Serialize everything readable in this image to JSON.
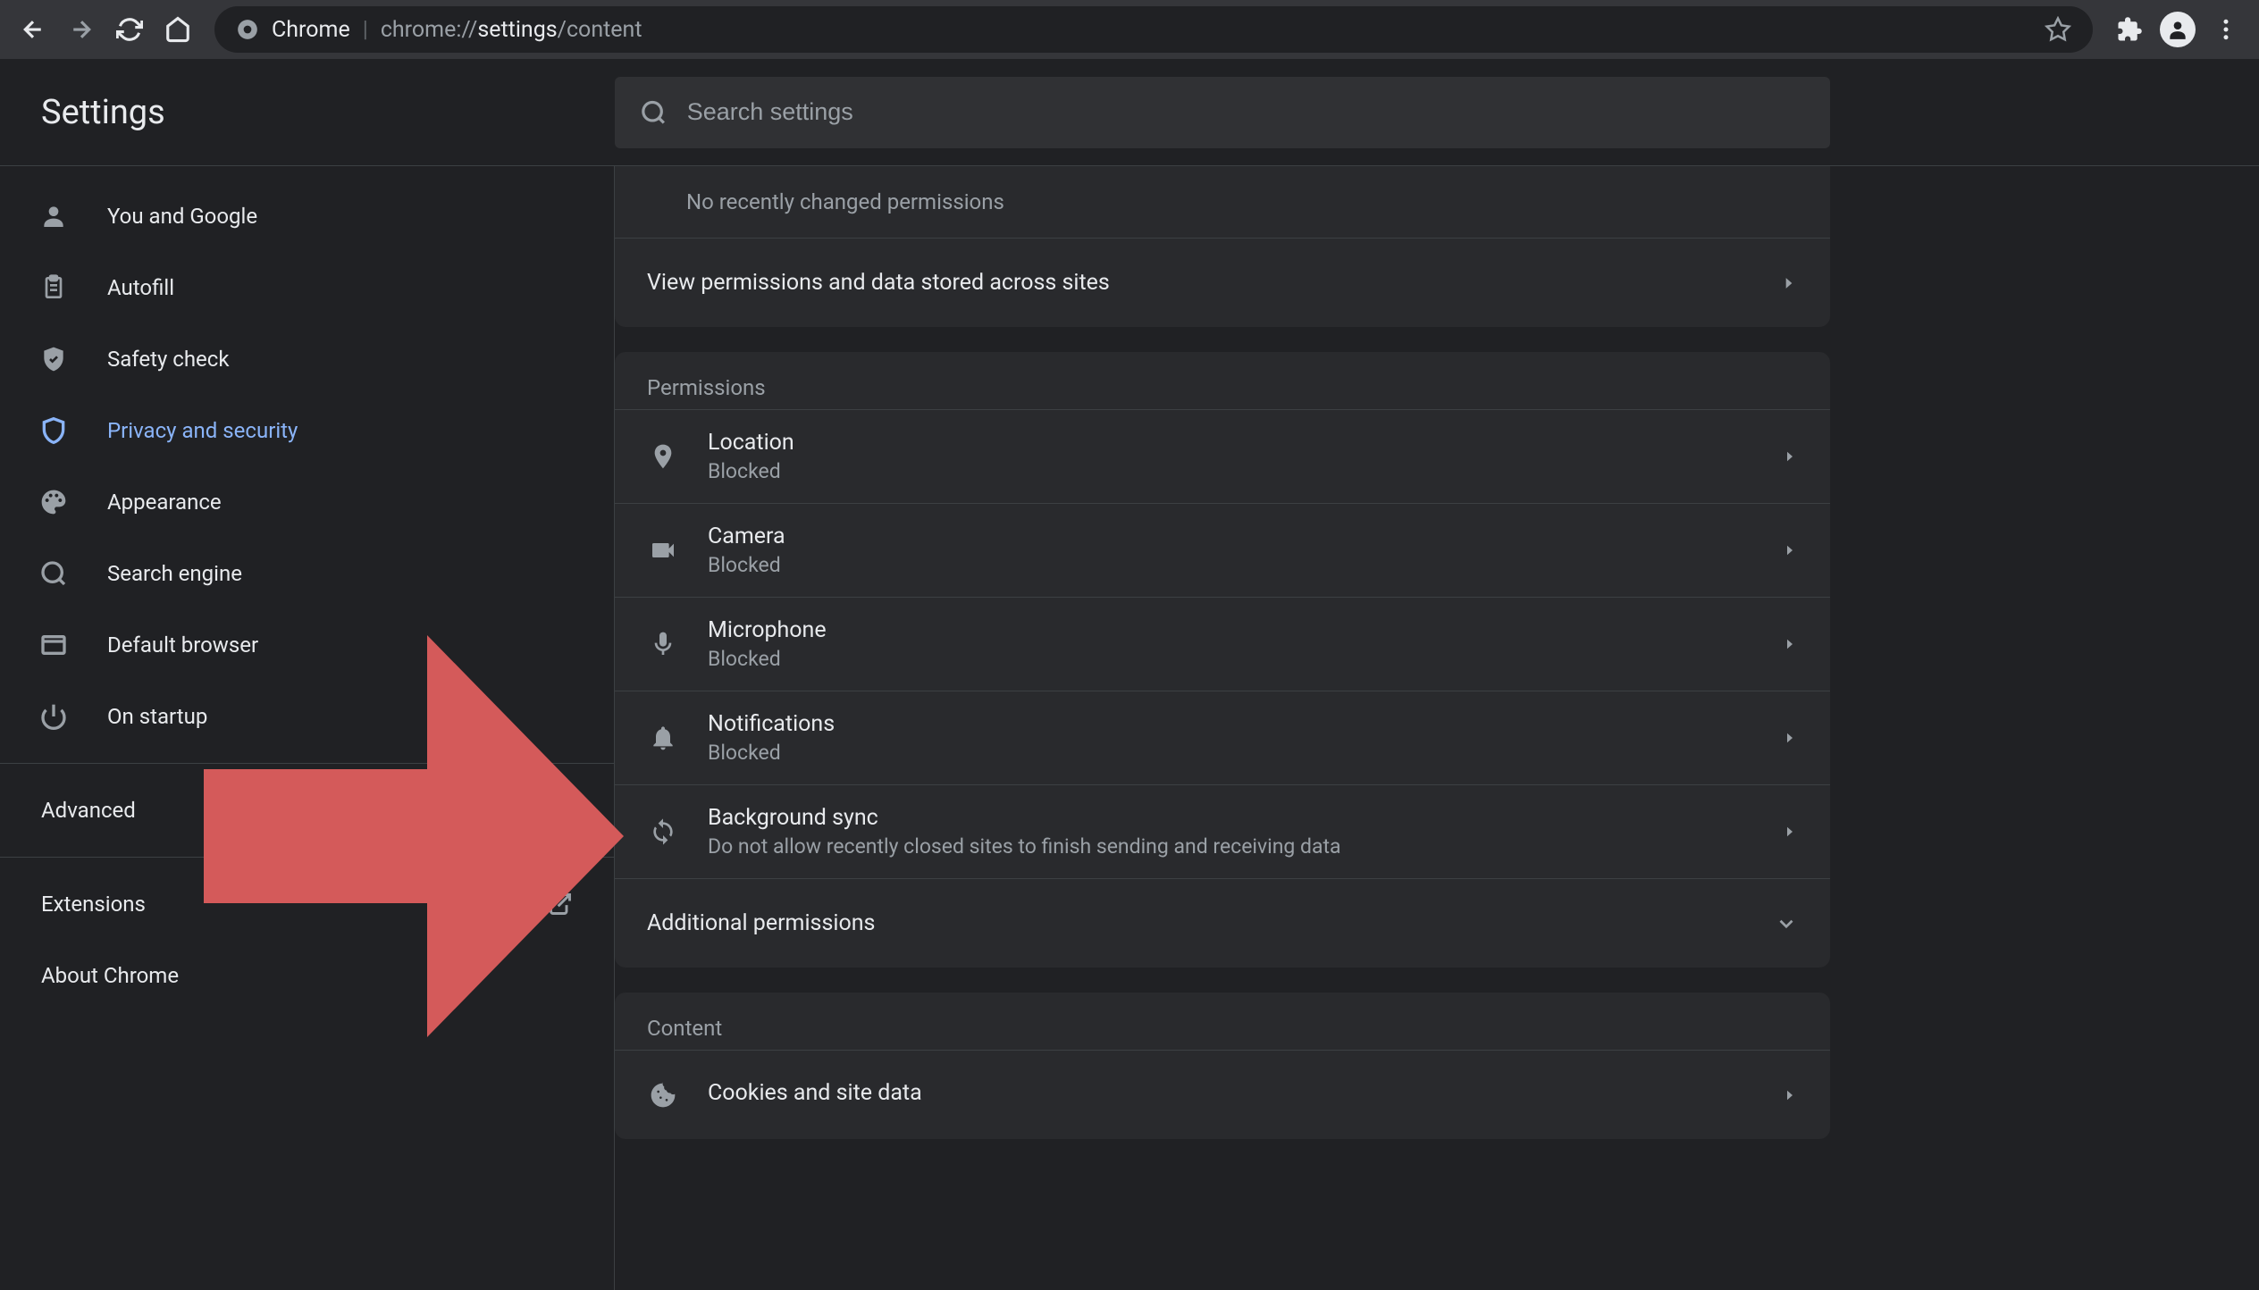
{
  "toolbar": {
    "browser_label": "Chrome",
    "url_prefix": "chrome://",
    "url_strong": "settings",
    "url_suffix": "/content"
  },
  "header": {
    "title": "Settings",
    "search_placeholder": "Search settings"
  },
  "sidebar": {
    "items": [
      {
        "label": "You and Google",
        "icon": "person"
      },
      {
        "label": "Autofill",
        "icon": "autofill"
      },
      {
        "label": "Safety check",
        "icon": "safety"
      },
      {
        "label": "Privacy and security",
        "icon": "shield",
        "active": true
      },
      {
        "label": "Appearance",
        "icon": "palette"
      },
      {
        "label": "Search engine",
        "icon": "search"
      },
      {
        "label": "Default browser",
        "icon": "browser"
      },
      {
        "label": "On startup",
        "icon": "power"
      }
    ],
    "advanced_label": "Advanced",
    "extensions_label": "Extensions",
    "about_label": "About Chrome"
  },
  "content": {
    "recent_empty": "No recently changed permissions",
    "view_permissions": "View permissions and data stored across sites",
    "permissions_heading": "Permissions",
    "permissions": [
      {
        "title": "Location",
        "sub": "Blocked",
        "icon": "location"
      },
      {
        "title": "Camera",
        "sub": "Blocked",
        "icon": "camera"
      },
      {
        "title": "Microphone",
        "sub": "Blocked",
        "icon": "mic"
      },
      {
        "title": "Notifications",
        "sub": "Blocked",
        "icon": "bell"
      },
      {
        "title": "Background sync",
        "sub": "Do not allow recently closed sites to finish sending and receiving data",
        "icon": "sync"
      }
    ],
    "additional_permissions": "Additional permissions",
    "content_heading": "Content",
    "content_items": [
      {
        "title": "Cookies and site data",
        "sub": "",
        "icon": "cookie"
      }
    ]
  }
}
